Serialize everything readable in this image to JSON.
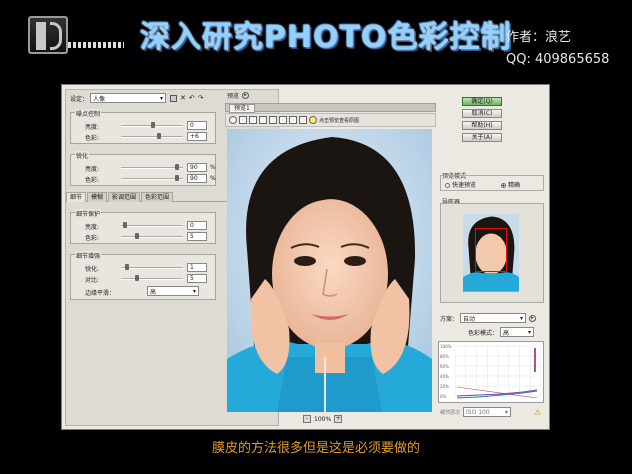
{
  "header": {
    "banner": "深入研究PHOTO色彩控制",
    "author": "作者：浪艺",
    "qq": "QQ: 409865658"
  },
  "caption": "膜皮的方法很多但是这是必须要做的",
  "dialog": {
    "settings_label": "设定：",
    "settings_value": "人像",
    "noise": {
      "title": "噪点控制",
      "brightness_label": "亮度:",
      "brightness_value": "0",
      "color_label": "色彩:",
      "color_value": "+6"
    },
    "sharpen": {
      "title": "锐化",
      "brightness_label": "亮度:",
      "brightness_value": "90",
      "color_label": "色彩:",
      "color_value": "90",
      "unit": "%"
    },
    "tabs": [
      "细节",
      "模糊",
      "影调范围",
      "色彩范围"
    ],
    "detail_protect": {
      "title": "细节保护",
      "brightness_label": "亮度:",
      "brightness_value": "0",
      "color_label": "色彩:",
      "color_value": "5"
    },
    "detail_enhance": {
      "title": "细节增强",
      "sharpen_label": "锐化:",
      "sharpen_value": "1",
      "contrast_label": "对比:",
      "contrast_value": "5",
      "smooth_label": "边缘平滑：",
      "smooth_value": "高"
    },
    "preview": {
      "label": "预览",
      "tab": "预览1",
      "hint": "点击预览查看原图",
      "zoom": "100%",
      "zoom_minus": "-",
      "zoom_plus": "+"
    },
    "buttons": {
      "ok": "确定(Q)",
      "cancel": "取消(C)",
      "help": "帮助(H)",
      "about": "关于(A)"
    },
    "preview_mode": {
      "title": "预览模式",
      "fast": "快速预览",
      "accurate": "精确"
    },
    "navigator": {
      "title": "导航器"
    },
    "scheme": {
      "label": "方案：",
      "value": "自动",
      "color_label": "色彩模式：",
      "color_value": "高",
      "y_ticks": [
        "100%",
        "80%",
        "60%",
        "40%",
        "20%",
        "0%"
      ],
      "bottom_label": "细节层次",
      "bottom_value": "ISO 100"
    }
  }
}
